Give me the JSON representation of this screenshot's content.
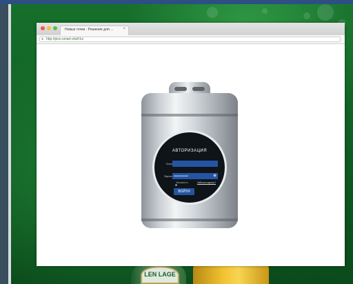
{
  "browser": {
    "tab_title": "Новые точки - Решение для ...",
    "tab_close": "×",
    "url": "http://pivo.smart-shelf.kz"
  },
  "login": {
    "title": "АВТОРИЗАЦИЯ",
    "login_label": "Логин",
    "login_value": "",
    "password_label": "Пароль",
    "password_value": "••••••••••••",
    "remember_label": "Запомнить",
    "forgot_label": "Забыли пароль?",
    "submit_label": "ВОЙТИ"
  },
  "beer": {
    "bottle_label": "LEN LAGE"
  },
  "colors": {
    "background": "#0d5a1f",
    "field": "#2554a3",
    "disc": "#0f1418",
    "top_bar": "#2d4f83"
  },
  "icons": {
    "lock": "lock-icon",
    "eye": "eye-icon",
    "close": "close-icon"
  }
}
